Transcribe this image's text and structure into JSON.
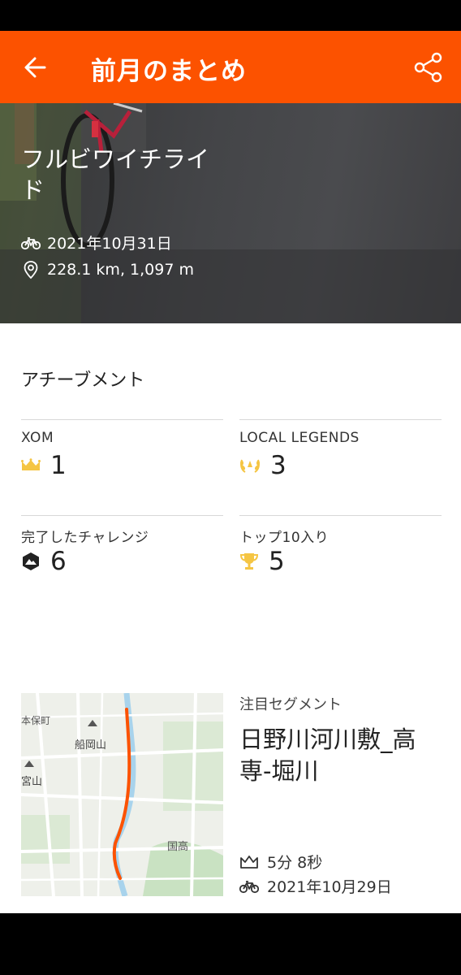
{
  "app_bar": {
    "title": "前月のまとめ",
    "back_icon": "arrow-left-icon",
    "share_icon": "share-icon"
  },
  "hero": {
    "title": "フルビワイチライド",
    "date": "2021年10月31日",
    "distance": "228.1 km, 1,097 m"
  },
  "achievements": {
    "title": "アチーブメント",
    "stats": [
      {
        "label": "XOM",
        "value": "1",
        "icon": "crown-icon"
      },
      {
        "label": "LOCAL LEGENDS",
        "value": "3",
        "icon": "laurel-icon"
      },
      {
        "label": "完了したチャレンジ",
        "value": "6",
        "icon": "challenge-badge-icon"
      },
      {
        "label": "トップ10入り",
        "value": "5",
        "icon": "trophy-icon"
      }
    ]
  },
  "segment": {
    "label": "注目セグメント",
    "name": "日野川河川敷_高専-堀川",
    "time": "5分 8秒",
    "date": "2021年10月29日",
    "map_labels": [
      "本保町",
      "船岡山",
      "宮山",
      "国高"
    ]
  },
  "colors": {
    "brand": "#fc5200",
    "gold": "#f5c543",
    "route": "#fc5200"
  }
}
